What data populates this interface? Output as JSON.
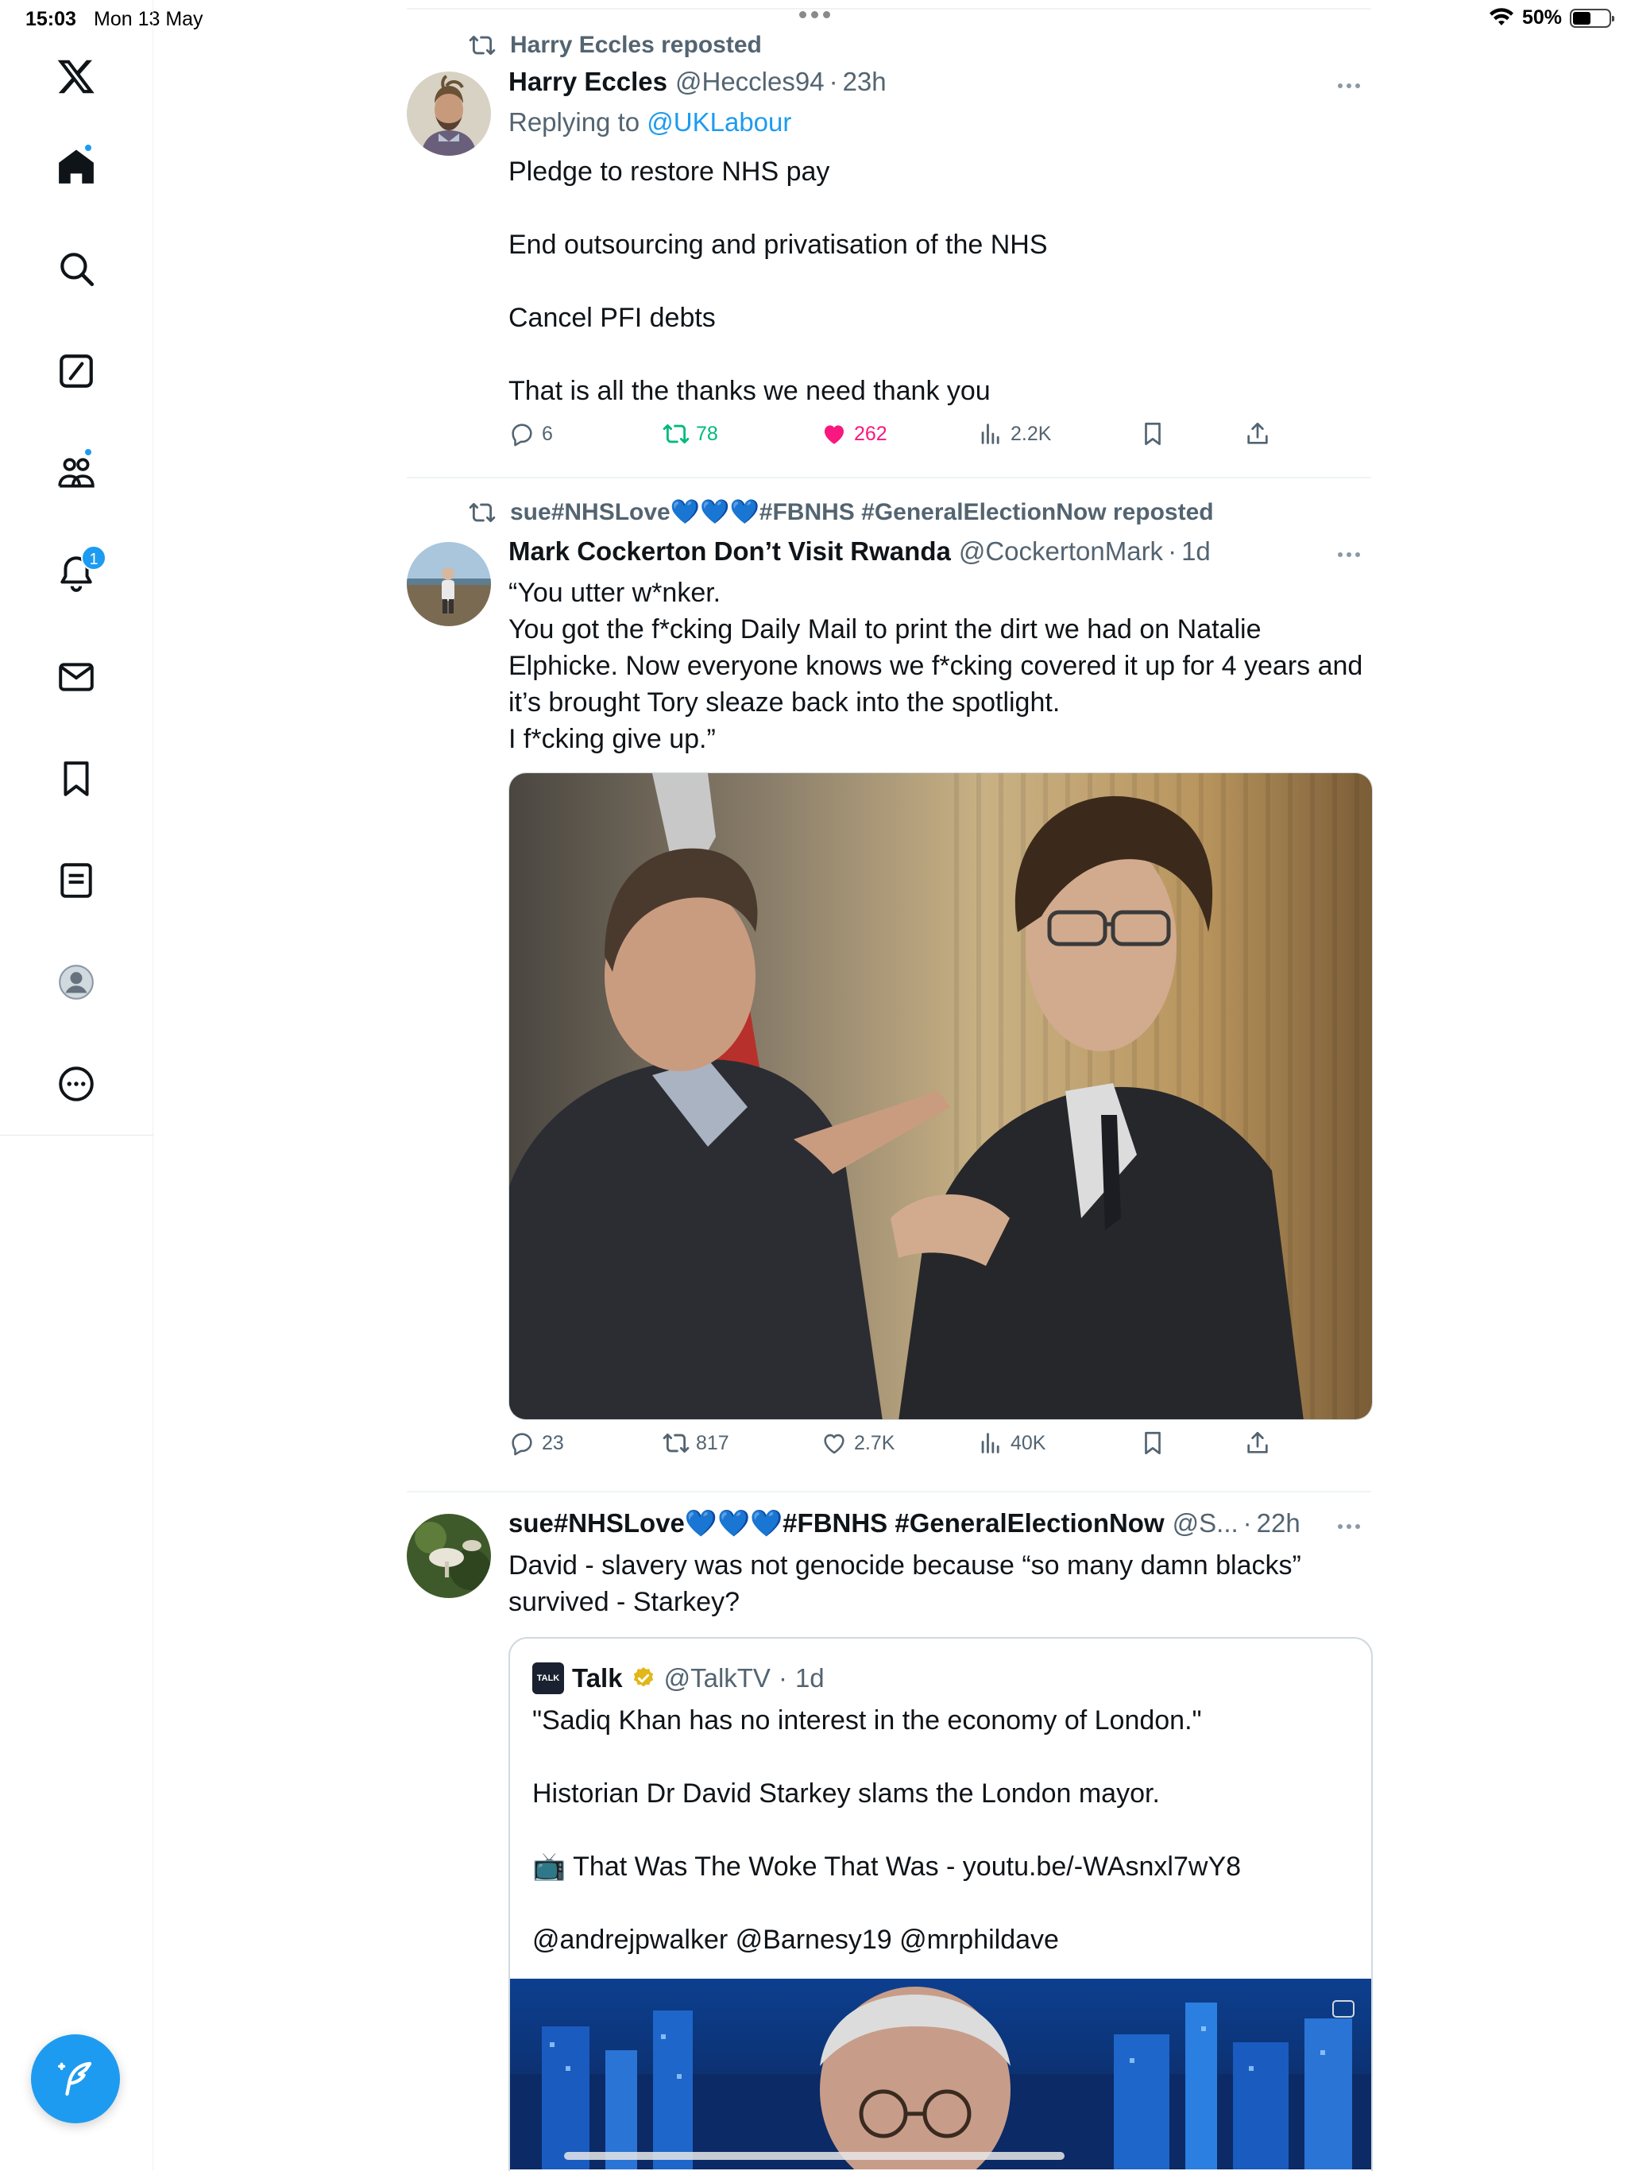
{
  "status_bar": {
    "time": "15:03",
    "date": "Mon 13 May",
    "battery": "50%",
    "battery_level": 0.5
  },
  "sidebar": {
    "items": [
      {
        "name": "home",
        "icon": "home-icon",
        "dot": true
      },
      {
        "name": "explore",
        "icon": "search-icon"
      },
      {
        "name": "grok",
        "icon": "grok-icon"
      },
      {
        "name": "communities",
        "icon": "communities-icon",
        "dot": true
      },
      {
        "name": "notifications",
        "icon": "bell-icon",
        "badge": "1"
      },
      {
        "name": "messages",
        "icon": "mail-icon"
      },
      {
        "name": "bookmarks",
        "icon": "bookmark-icon"
      },
      {
        "name": "lists",
        "icon": "list-icon"
      },
      {
        "name": "profile",
        "icon": "profile-icon"
      },
      {
        "name": "more",
        "icon": "more-icon"
      }
    ],
    "compose_icon": "compose-icon"
  },
  "colors": {
    "accent": "#1d9bf0",
    "like": "#f91880",
    "repost": "#00ba7c",
    "secondary": "#536471"
  },
  "tweets": [
    {
      "repost_label": "Harry Eccles reposted",
      "name": "Harry Eccles",
      "handle": "@Heccles94",
      "time": "23h",
      "reply_prefix": "Replying to",
      "reply_to": "@UKLabour",
      "lines": [
        "Pledge to restore NHS pay",
        "End outsourcing and privatisation of the NHS",
        "Cancel PFI debts",
        "That is all the thanks we need thank you"
      ],
      "stats": {
        "replies": "6",
        "reposts": "78",
        "likes": "262",
        "views": "2.2K"
      }
    },
    {
      "repost_label": "sue#NHSLove💙💙💙#FBNHS #GeneralElectionNow reposted",
      "name": "Mark Cockerton Don’t Visit Rwanda",
      "handle": "@CockertonMark",
      "time": "1d",
      "lines": [
        "“You utter w*nker.",
        "You got the f*cking Daily Mail to print the dirt we had on Natalie Elphicke. Now everyone knows we f*cking covered it up for 4 years and it’s brought Tory sleaze back into the spotlight.",
        "I f*cking give up.”"
      ],
      "stats": {
        "replies": "23",
        "reposts": "817",
        "likes": "2.7K",
        "views": "40K"
      }
    },
    {
      "name": "sue#NHSLove💙💙💙#FBNHS #GeneralElectionNow",
      "handle": "@S...",
      "time": "22h",
      "text": "David - slavery was not genocide because “so many damn blacks” survived - Starkey?",
      "quote": {
        "logo": "TALK",
        "name": "Talk",
        "handle": "@TalkTV",
        "time": "1d",
        "lines": [
          "\"Sadiq Khan has no interest in the economy of London.\"",
          "Historian Dr David Starkey slams the London mayor.",
          "📺 That Was The Woke That Was - youtu.be/-WAsnxl7wY8",
          "@andrejpwalker @Barnesy19 @mrphildave"
        ]
      }
    }
  ]
}
